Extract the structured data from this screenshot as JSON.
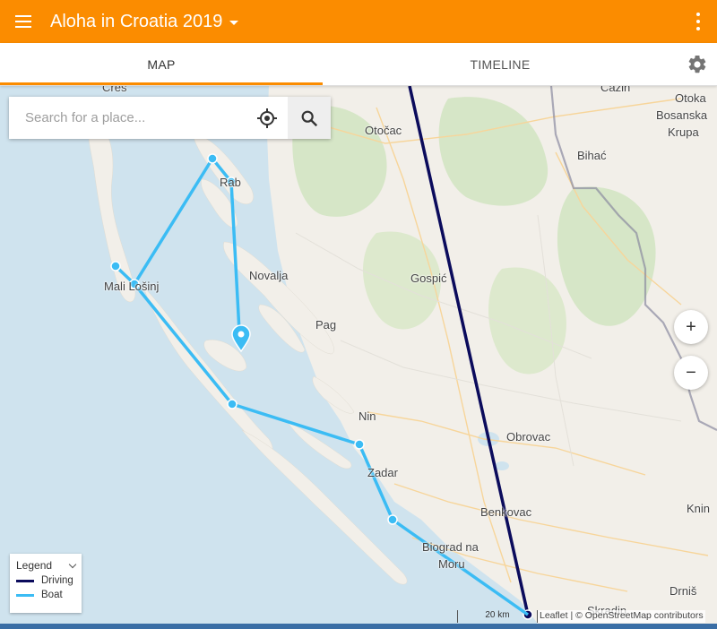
{
  "app": {
    "title": "Aloha in Croatia 2019",
    "accent_color": "#fb8c00"
  },
  "tabs": [
    {
      "label": "MAP",
      "active": true
    },
    {
      "label": "TIMELINE",
      "active": false
    }
  ],
  "icons": {
    "menu": "menu-icon",
    "more": "more-vert-icon",
    "settings": "gear-icon",
    "locate": "my-location-icon",
    "search": "search-icon"
  },
  "search": {
    "placeholder": "Search for a place...",
    "value": ""
  },
  "map": {
    "zoom_in_label": "+",
    "zoom_out_label": "−",
    "scale_label": "20 km",
    "attribution": "Leaflet | © OpenStreetMap contributors",
    "places": [
      {
        "name": "Cres"
      },
      {
        "name": "Otočac"
      },
      {
        "name": "Rab"
      },
      {
        "name": "Bihać"
      },
      {
        "name": "Otoka"
      },
      {
        "name": "Bosanska"
      },
      {
        "name": "Krupa"
      },
      {
        "name": "Cazin"
      },
      {
        "name": "Novalja"
      },
      {
        "name": "Gospić"
      },
      {
        "name": "Mali Lošinj"
      },
      {
        "name": "Pag"
      },
      {
        "name": "Nin"
      },
      {
        "name": "Obrovac"
      },
      {
        "name": "Zadar"
      },
      {
        "name": "Benkovac"
      },
      {
        "name": "Knin"
      },
      {
        "name": "Biograd na"
      },
      {
        "name": "Moru"
      },
      {
        "name": "Drniš"
      },
      {
        "name": "Skradin"
      }
    ],
    "routes": {
      "driving_color": "#0b0b5c",
      "boat_color": "#3bbcf4"
    }
  },
  "legend": {
    "title": "Legend",
    "items": [
      {
        "label": "Driving",
        "color": "#0b0b5c"
      },
      {
        "label": "Boat",
        "color": "#3bbcf4"
      }
    ]
  }
}
